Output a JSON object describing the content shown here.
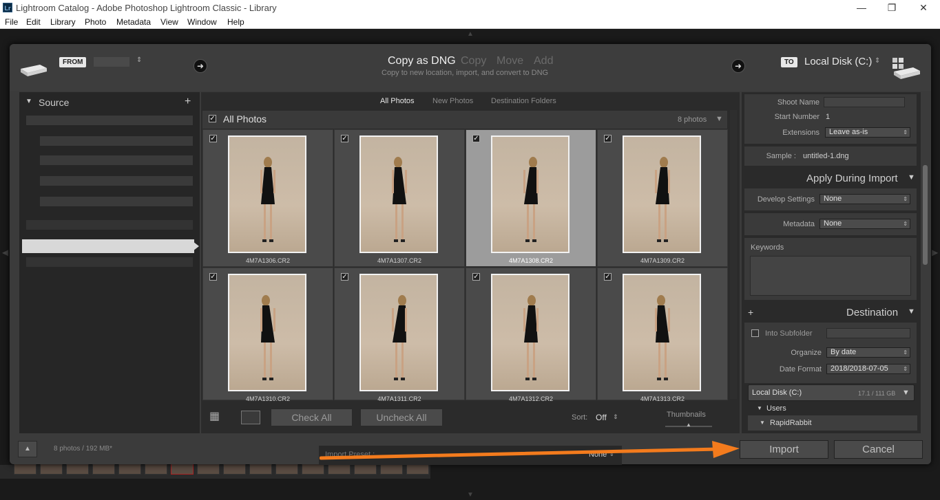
{
  "window": {
    "title": "Lightroom Catalog - Adobe Photoshop Lightroom Classic - Library",
    "logo": "Lr",
    "buttons": {
      "minimize": "—",
      "restore": "❐",
      "close": "✕"
    }
  },
  "menu": [
    "File",
    "Edit",
    "Library",
    "Photo",
    "Metadata",
    "View",
    "Window",
    "Help"
  ],
  "header": {
    "from_tag": "FROM",
    "to_tag": "TO",
    "destination_drive": "Local Disk (C:)",
    "modes": [
      "Copy as DNG",
      "Copy",
      "Move",
      "Add"
    ],
    "active_mode_subtitle": "Copy to new location, import, and convert to DNG"
  },
  "source": {
    "title": "Source",
    "add_icon": "plus-icon"
  },
  "grid": {
    "tabs": [
      "All Photos",
      "New Photos",
      "Destination Folders"
    ],
    "group_label": "All Photos",
    "count_label": "8 photos",
    "photos": [
      {
        "name": "4M7A1306.CR2",
        "checked": true,
        "selected": false
      },
      {
        "name": "4M7A1307.CR2",
        "checked": true,
        "selected": false
      },
      {
        "name": "4M7A1308.CR2",
        "checked": true,
        "selected": true
      },
      {
        "name": "4M7A1309.CR2",
        "checked": true,
        "selected": false
      },
      {
        "name": "4M7A1310.CR2",
        "checked": true,
        "selected": false
      },
      {
        "name": "4M7A1311.CR2",
        "checked": true,
        "selected": false
      },
      {
        "name": "4M7A1312.CR2",
        "checked": true,
        "selected": false
      },
      {
        "name": "4M7A1313.CR2",
        "checked": true,
        "selected": false
      }
    ],
    "toolbar": {
      "check_all": "Check All",
      "uncheck_all": "Uncheck All",
      "sort_label": "Sort:",
      "sort_value": "Off",
      "thumbnails_label": "Thumbnails"
    }
  },
  "right_panel": {
    "shoot_name_label": "Shoot Name",
    "start_number_label": "Start Number",
    "start_number_value": "1",
    "extensions_label": "Extensions",
    "extensions_value": "Leave as-is",
    "sample_label": "Sample :",
    "sample_value": "untitled-1.dng",
    "apply_title": "Apply During Import",
    "develop_label": "Develop Settings",
    "develop_value": "None",
    "metadata_label": "Metadata",
    "metadata_value": "None",
    "keywords_label": "Keywords",
    "destination_title": "Destination",
    "into_subfolder_label": "Into Subfolder",
    "organize_label": "Organize",
    "organize_value": "By date",
    "date_format_label": "Date Format",
    "date_format_value": "2018/2018-07-05",
    "disk_label": "Local Disk (C:)",
    "disk_space": "17.1 / 111 GB",
    "folders": [
      "Users",
      "RapidRabbit"
    ]
  },
  "bottom": {
    "summary": "8 photos / 192 MB*",
    "import_preset_label": "Import Preset :",
    "import_preset_value": "None",
    "import_button": "Import",
    "cancel_button": "Cancel"
  },
  "colors": {
    "annotation_arrow": "#f37b1d",
    "dialog_bg": "#3b3b3b",
    "selected_cell": "#9c9c9c"
  }
}
